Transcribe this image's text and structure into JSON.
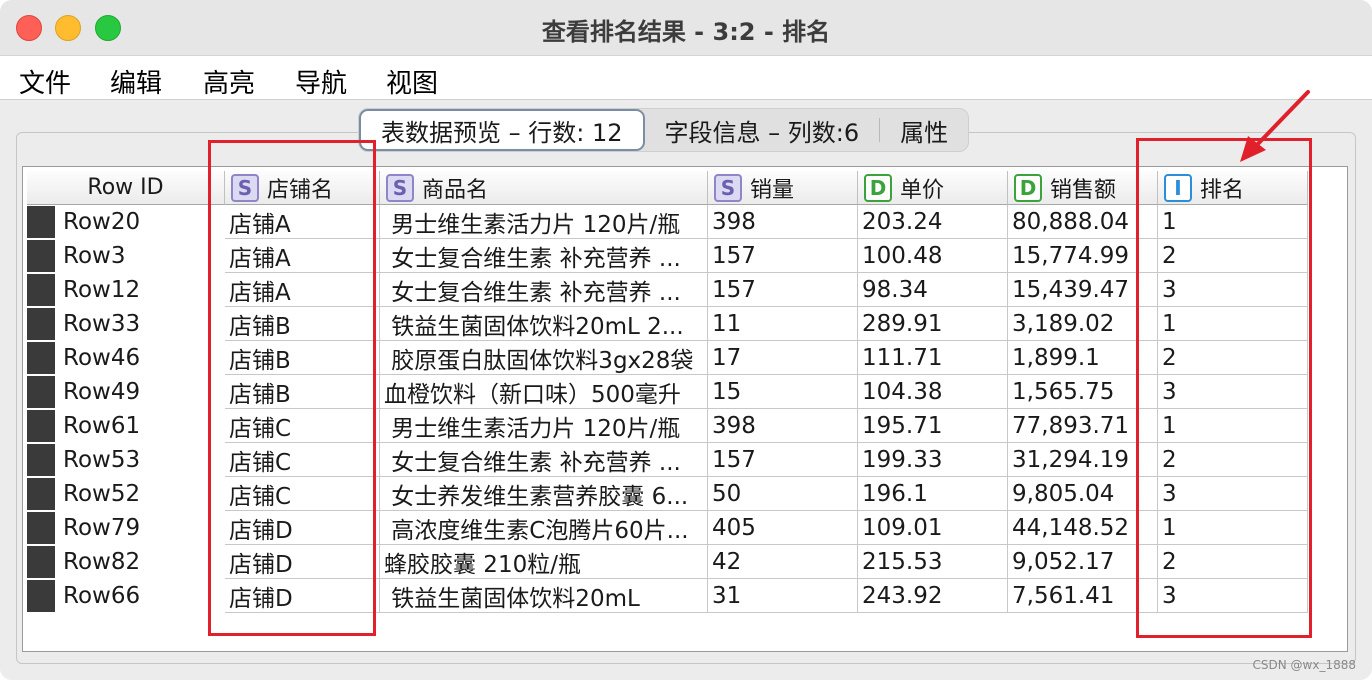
{
  "window": {
    "title": "查看排名结果 - 3:2 - 排名"
  },
  "menu": [
    "文件",
    "编辑",
    "高亮",
    "导航",
    "视图"
  ],
  "tabs": [
    "表数据预览 – 行数: 12",
    "字段信息 – 列数:6",
    "属性"
  ],
  "table": {
    "columns": [
      {
        "label": "Row ID",
        "type": ""
      },
      {
        "label": "店铺名",
        "type": "S"
      },
      {
        "label": "商品名",
        "type": "S"
      },
      {
        "label": "销量",
        "type": "S"
      },
      {
        "label": "单价",
        "type": "D"
      },
      {
        "label": "销售额",
        "type": "D"
      },
      {
        "label": "排名",
        "type": "I"
      }
    ],
    "rows": [
      [
        "Row20",
        "店铺A",
        " 男士维生素活力片 120片/瓶",
        "398",
        "203.24",
        "80,888.04",
        "1"
      ],
      [
        "Row3",
        "店铺A",
        " 女士复合维生素 补充营养 ...",
        "157",
        "100.48",
        "15,774.99",
        "2"
      ],
      [
        "Row12",
        "店铺A",
        " 女士复合维生素 补充营养 ...",
        "157",
        "98.34",
        "15,439.47",
        "3"
      ],
      [
        "Row33",
        "店铺B",
        " 铁益生菌固体饮料20mL 2...",
        "11",
        "289.91",
        "3,189.02",
        "1"
      ],
      [
        "Row46",
        "店铺B",
        " 胶原蛋白肽固体饮料3gx28袋",
        "17",
        "111.71",
        "1,899.1",
        "2"
      ],
      [
        "Row49",
        "店铺B",
        "血橙饮料（新口味）500毫升",
        "15",
        "104.38",
        "1,565.75",
        "3"
      ],
      [
        "Row61",
        "店铺C",
        " 男士维生素活力片 120片/瓶",
        "398",
        "195.71",
        "77,893.71",
        "1"
      ],
      [
        "Row53",
        "店铺C",
        " 女士复合维生素 补充营养 ...",
        "157",
        "199.33",
        "31,294.19",
        "2"
      ],
      [
        "Row52",
        "店铺C",
        " 女士养发维生素营养胶囊 6...",
        "50",
        "196.1",
        "9,805.04",
        "3"
      ],
      [
        "Row79",
        "店铺D",
        " 高浓度维生素C泡腾片60片...",
        "405",
        "109.01",
        "44,148.52",
        "1"
      ],
      [
        "Row82",
        "店铺D",
        "蜂胶胶囊 210粒/瓶",
        "42",
        "215.53",
        "9,052.17",
        "2"
      ],
      [
        "Row66",
        "店铺D",
        " 铁益生菌固体饮料20mL",
        "31",
        "243.92",
        "7,561.41",
        "3"
      ]
    ]
  },
  "colors": {
    "highlight": "#e0202a",
    "row_marker": "#3a3a3a"
  },
  "watermark": "CSDN @wx_1888"
}
